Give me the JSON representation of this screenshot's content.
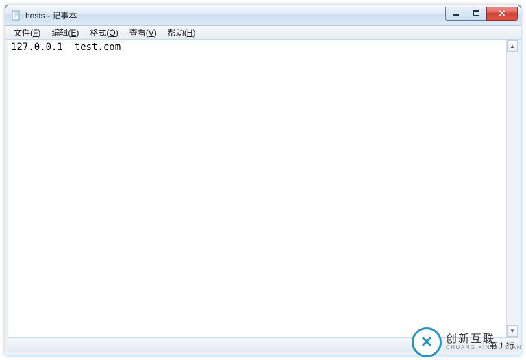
{
  "window": {
    "title": "hosts - 记事本"
  },
  "menubar": {
    "items": [
      {
        "label": "文件",
        "accel": "F"
      },
      {
        "label": "编辑",
        "accel": "E"
      },
      {
        "label": "格式",
        "accel": "O"
      },
      {
        "label": "查看",
        "accel": "V"
      },
      {
        "label": "帮助",
        "accel": "H"
      }
    ]
  },
  "editor": {
    "content": "127.0.0.1  test.com"
  },
  "statusbar": {
    "position": "第 1 行"
  },
  "watermark": {
    "cn": "创新互联",
    "en": "CHUANG XIN HU LIAN"
  }
}
